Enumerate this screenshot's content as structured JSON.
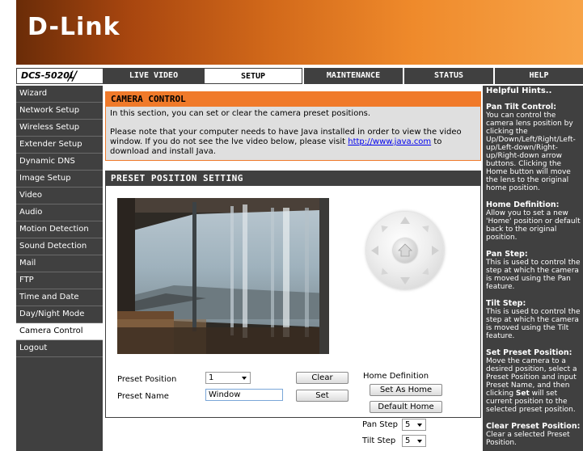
{
  "brand": {
    "logo": "D-Link",
    "model": "DCS-5020L"
  },
  "nav": {
    "tabs": [
      "LIVE VIDEO",
      "SETUP",
      "MAINTENANCE",
      "STATUS",
      "HELP"
    ],
    "active": "SETUP"
  },
  "sidebar": {
    "items": [
      "Wizard",
      "Network Setup",
      "Wireless Setup",
      "Extender Setup",
      "Dynamic DNS",
      "Image Setup",
      "Video",
      "Audio",
      "Motion Detection",
      "Sound Detection",
      "Mail",
      "FTP",
      "Time and Date",
      "Day/Night Mode",
      "Camera Control",
      "Logout"
    ],
    "active": "Camera Control"
  },
  "camera_control": {
    "title": "CAMERA CONTROL",
    "intro": "In this section, you can set or clear the camera preset positions.",
    "java_note_pre": "Please note that your computer needs to have Java installed in order to view the video window. If you do not see the lve video below, please visit ",
    "java_link": "http://www.java.com",
    "java_note_post": " to download and install Java."
  },
  "preset": {
    "title": "PRESET POSITION SETTING",
    "home_definition_label": "Home Definition",
    "set_as_home_button": "Set As Home",
    "default_home_button": "Default Home",
    "pan_step_label": "Pan Step",
    "pan_step_value": "5",
    "tilt_step_label": "Tilt Step",
    "tilt_step_value": "5",
    "preset_position_label": "Preset Position",
    "preset_position_value": "1",
    "preset_name_label": "Preset Name",
    "preset_name_value": "Window",
    "clear_button": "Clear",
    "set_button": "Set"
  },
  "hints": {
    "title": "Helpful Hints..",
    "sections": [
      {
        "heading": "Pan Tilt Control:",
        "text": "You can control the camera lens position by clicking the Up/Down/Left/Right/Left-up/Left-down/Right-up/Right-down arrow buttons. Clicking the Home button will move the lens to the original home position."
      },
      {
        "heading": "Home Definition:",
        "text": "Allow you to set a new 'Home' position or default back to the original position."
      },
      {
        "heading": "Pan Step:",
        "text": "This is used to control the step at which the camera is moved using the Pan feature."
      },
      {
        "heading": "Tilt Step:",
        "text": "This is used to control the step at which the camera is moved using the Tilt feature."
      },
      {
        "heading": "Set Preset Position:",
        "text_pre": "Move the camera to a desired position, select a Preset Position and input Preset Name, and then clicking ",
        "text_bold": "Set",
        "text_post": " will set current position to the selected preset position."
      },
      {
        "heading": "Clear Preset Position:",
        "text": "Clear a selected Preset Position."
      }
    ]
  },
  "colors": {
    "orange_accent": "#f07a2a",
    "dark_bar": "#404040",
    "link": "#0000ee"
  }
}
